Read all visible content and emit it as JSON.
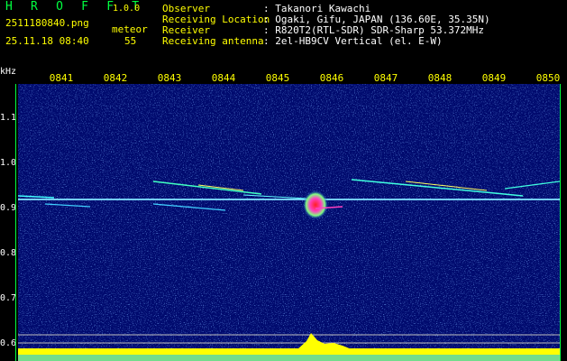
{
  "header": {
    "title": "H R O F F T",
    "version": "1.0.0",
    "file_name": "2511180840.png",
    "timestamp": "25.11.18 08:40",
    "meteor_label": "meteor",
    "meteor_count": "55"
  },
  "info": [
    {
      "label": "Observer",
      "value": ": Takanori Kawachi"
    },
    {
      "label": "Receiving Location",
      "value": ": Ogaki, Gifu, JAPAN (136.60E, 35.35N)"
    },
    {
      "label": "Receiver",
      "value": ": R820T2(RTL-SDR) SDR-Sharp 53.372MHz"
    },
    {
      "label": "Receiving antenna",
      "value": ": 2el-HB9CV Vertical (el. E-W)"
    }
  ],
  "axes": {
    "y_unit": "kHz",
    "y_ticks": [
      "1.1",
      "1.0",
      "0.9",
      "0.8",
      "0.7",
      "0.6"
    ],
    "x_ticks": [
      "0841",
      "0842",
      "0843",
      "0844",
      "0845",
      "0846",
      "0847",
      "0848",
      "0849",
      "0850"
    ]
  },
  "colors": {
    "background": "#000000",
    "spectrogram_bg": "#000a6e",
    "label": "#ffffff",
    "accent": "#ffff00",
    "title": "#00ff40"
  }
}
